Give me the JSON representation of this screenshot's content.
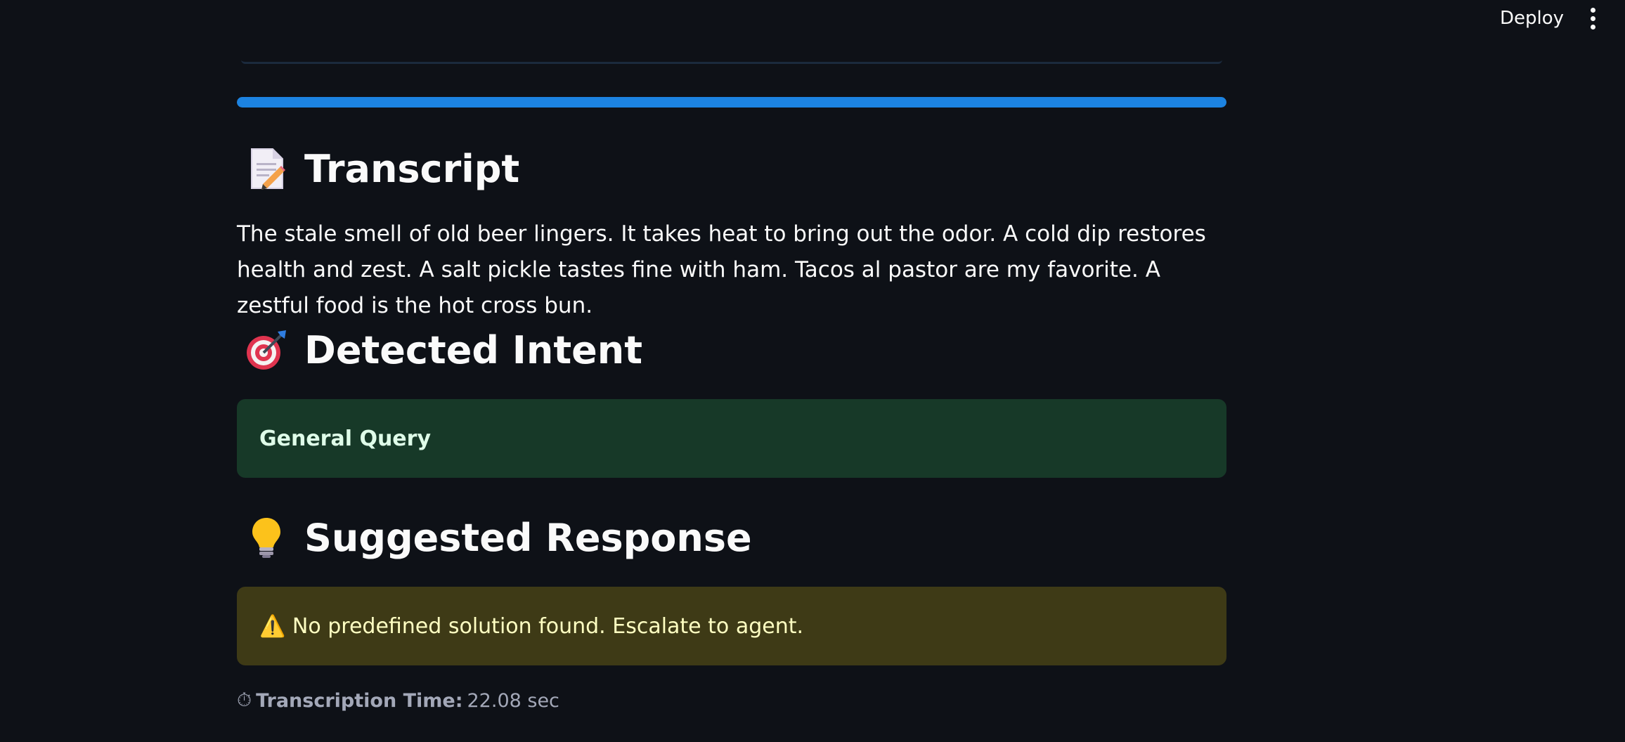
{
  "header": {
    "deploy_label": "Deploy",
    "menu_icon": "more-vert-icon"
  },
  "progress": {
    "value_percent": 100,
    "color": "#1c83e1"
  },
  "transcript": {
    "heading_icon": "📝",
    "heading": "Transcript",
    "text": "The stale smell of old beer lingers. It takes heat to bring out the odor. A cold dip restores health and zest. A salt pickle tastes fine with ham. Tacos al pastor are my favorite. A zestful food is the hot cross bun."
  },
  "intent": {
    "heading_icon": "🎯",
    "heading": "Detected Intent",
    "value": "General Query",
    "box_color": "#173928"
  },
  "response": {
    "heading_icon": "💡",
    "heading": "Suggested Response",
    "value": "⚠️ No predefined solution found. Escalate to agent.",
    "box_color": "#3e3a16"
  },
  "timing": {
    "icon": "⏱",
    "label": "Transcription Time:",
    "value": "22.08 sec"
  }
}
